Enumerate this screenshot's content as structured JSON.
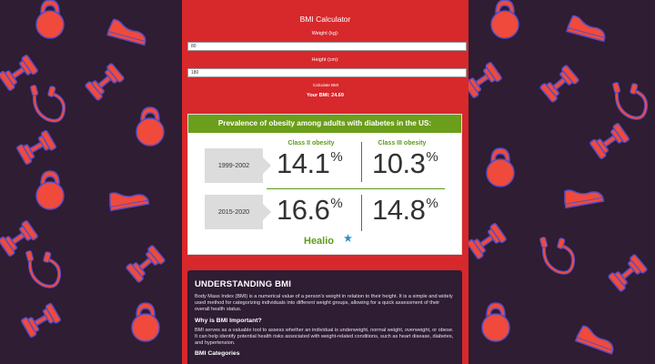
{
  "calculator": {
    "title": "BMI Calculator",
    "weight_label": "Weight (kg):",
    "weight_value": "80",
    "height_label": "Height (cm):",
    "height_value": "180",
    "calculate_label": "Calculate BMI",
    "result_text": "Your BMI: 24.69"
  },
  "infographic": {
    "title": "Prevalence of obesity among adults with diabetes in the US:",
    "col1": "Class II obesity",
    "col2": "Class III obesity",
    "rows": [
      {
        "period": "1999-2002",
        "class2": "14.1",
        "class3": "10.3"
      },
      {
        "period": "2015-2020",
        "class2": "16.6",
        "class3": "14.8"
      }
    ],
    "percent_sign": "%",
    "logo": "Healio"
  },
  "article": {
    "heading": "UNDERSTANDING BMI",
    "intro": "Body Mass Index (BMI) is a numerical value of a person's weight in relation to their height. It is a simple and widely used method for categorizing individuals into different weight groups, allowing for a quick assessment of their overall health status.",
    "why_heading": "Why is BMI Important?",
    "why_text": "BMI serves as a valuable tool to assess whether an individual is underweight, normal weight, overweight, or obese. It can help identify potential health risks associated with weight-related conditions, such as heart disease, diabetes, and hypertension.",
    "categories_heading": "BMI Categories"
  },
  "colors": {
    "page_background": "#2e1d33",
    "panel_red": "#d7282c",
    "pattern_red": "#ef4a3c",
    "pattern_outline": "#5a4cc4",
    "accent_green": "#6b9e1a"
  },
  "icons": [
    "dumbbell-icon",
    "sneaker-icon",
    "kettlebell-icon",
    "jump-rope-icon"
  ]
}
